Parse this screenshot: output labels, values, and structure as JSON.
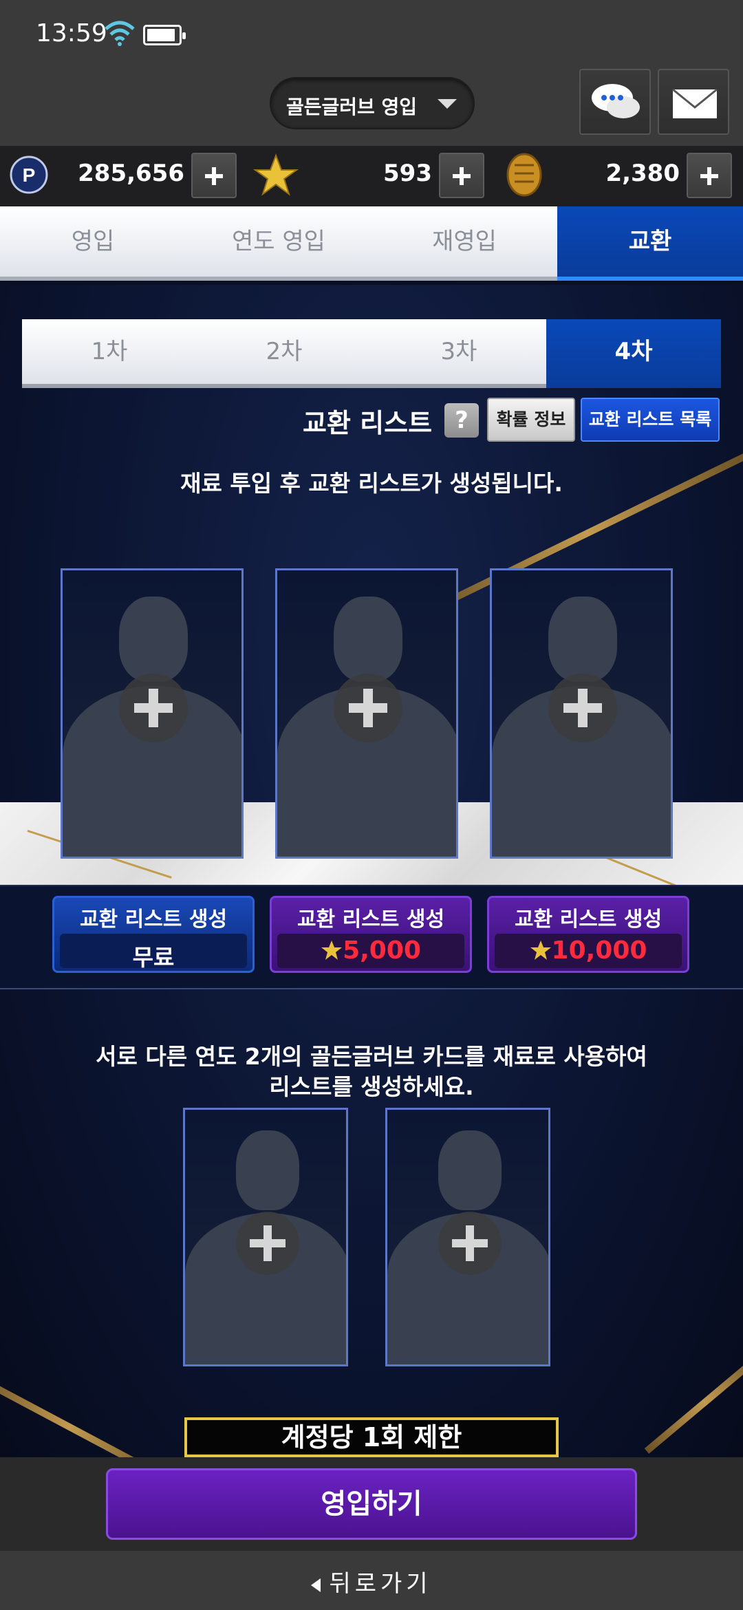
{
  "status": {
    "time": "13:59",
    "battery_level": 0.9
  },
  "header": {
    "mode_select": "골든글러브 영입"
  },
  "currency": [
    {
      "name": "p-point",
      "icon": "p-coin-icon",
      "value": "285,656"
    },
    {
      "name": "star",
      "icon": "gold-star-icon",
      "value": "593"
    },
    {
      "name": "glove",
      "icon": "golden-glove-icon",
      "value": "2,380"
    }
  ],
  "main_tabs": [
    {
      "label": "영입",
      "active": false
    },
    {
      "label": "연도 영입",
      "active": false
    },
    {
      "label": "재영입",
      "active": false
    },
    {
      "label": "교환",
      "active": true
    }
  ],
  "sub_tabs": [
    {
      "label": "1차",
      "active": false
    },
    {
      "label": "2차",
      "active": false
    },
    {
      "label": "3차",
      "active": false
    },
    {
      "label": "4차",
      "active": true
    }
  ],
  "exchange": {
    "title": "교환 리스트",
    "help": "?",
    "prob_btn": "확률 정보",
    "list_btn": "교환 리스트 목록",
    "info": "재료 투입 후 교환 리스트가 생성됩니다."
  },
  "generate": [
    {
      "label": "교환 리스트 생성",
      "price": "무료",
      "free": true
    },
    {
      "label": "교환 리스트 생성",
      "price": "5,000",
      "free": false
    },
    {
      "label": "교환 리스트 생성",
      "price": "10,000",
      "free": false
    }
  ],
  "material": {
    "info_line1": "서로 다른 연도 2개의 골든글러브 카드를 재료로 사용하여",
    "info_line2": "리스트를 생성하세요.",
    "limit": "계정당 1회 제한"
  },
  "bottom": {
    "enter": "영입하기",
    "back": "뒤로가기"
  },
  "colors": {
    "accent_blue": "#0a48b8",
    "accent_purple": "#5a1fa6",
    "price_red": "#ff2a3c",
    "limit_gold": "#e7c74a"
  }
}
